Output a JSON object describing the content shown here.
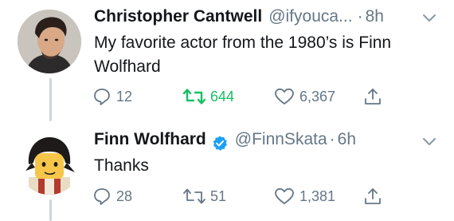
{
  "tweets": [
    {
      "author": "Christopher Cantwell",
      "handle": "@ifyouca...",
      "separator": "·",
      "time": "8h",
      "text": "My favorite actor from the 1980’s is Finn Wolfhard",
      "replies": "12",
      "retweets": "644",
      "likes": "6,367",
      "retweeted": true,
      "verified": false
    },
    {
      "author": "Finn Wolfhard",
      "handle": "@FinnSkata",
      "separator": "·",
      "time": "6h",
      "text": "Thanks",
      "replies": "28",
      "retweets": "51",
      "likes": "1,381",
      "retweeted": false,
      "verified": true
    }
  ],
  "icons": [
    "reply-icon",
    "retweet-icon",
    "like-icon",
    "share-icon",
    "chevron-down-icon",
    "verified-badge-icon"
  ],
  "colors": {
    "retweet_active": "#17bf63",
    "secondary_text": "#657786",
    "verified": "#1da1f2",
    "thread_line": "#ccd6dd"
  }
}
